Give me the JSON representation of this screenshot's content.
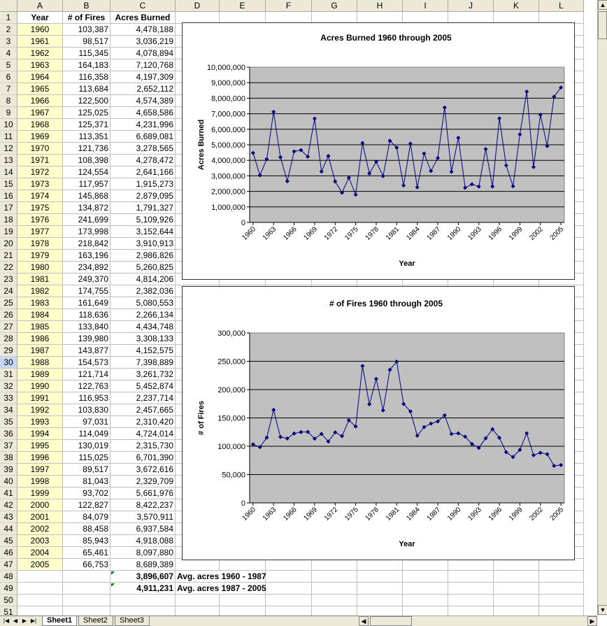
{
  "columns": [
    "A",
    "B",
    "C",
    "D",
    "E",
    "F",
    "G",
    "H",
    "I",
    "J",
    "K",
    "L"
  ],
  "header": {
    "year": "Year",
    "fires": "# of Fires",
    "acres": "Acres Burned"
  },
  "rows": [
    {
      "year": "1960",
      "fires": "103,387",
      "acres": "4,478,188"
    },
    {
      "year": "1961",
      "fires": "98,517",
      "acres": "3,036,219"
    },
    {
      "year": "1962",
      "fires": "115,345",
      "acres": "4,078,894"
    },
    {
      "year": "1963",
      "fires": "164,183",
      "acres": "7,120,768"
    },
    {
      "year": "1964",
      "fires": "116,358",
      "acres": "4,197,309"
    },
    {
      "year": "1965",
      "fires": "113,684",
      "acres": "2,652,112"
    },
    {
      "year": "1966",
      "fires": "122,500",
      "acres": "4,574,389"
    },
    {
      "year": "1967",
      "fires": "125,025",
      "acres": "4,658,586"
    },
    {
      "year": "1968",
      "fires": "125,371",
      "acres": "4,231,996"
    },
    {
      "year": "1969",
      "fires": "113,351",
      "acres": "6,689,081"
    },
    {
      "year": "1970",
      "fires": "121,736",
      "acres": "3,278,565"
    },
    {
      "year": "1971",
      "fires": "108,398",
      "acres": "4,278,472"
    },
    {
      "year": "1972",
      "fires": "124,554",
      "acres": "2,641,166"
    },
    {
      "year": "1973",
      "fires": "117,957",
      "acres": "1,915,273"
    },
    {
      "year": "1974",
      "fires": "145,868",
      "acres": "2,879,095"
    },
    {
      "year": "1975",
      "fires": "134,872",
      "acres": "1,791,327"
    },
    {
      "year": "1976",
      "fires": "241,699",
      "acres": "5,109,926"
    },
    {
      "year": "1977",
      "fires": "173,998",
      "acres": "3,152,644"
    },
    {
      "year": "1978",
      "fires": "218,842",
      "acres": "3,910,913"
    },
    {
      "year": "1979",
      "fires": "163,196",
      "acres": "2,986,826"
    },
    {
      "year": "1980",
      "fires": "234,892",
      "acres": "5,260,825"
    },
    {
      "year": "1981",
      "fires": "249,370",
      "acres": "4,814,206"
    },
    {
      "year": "1982",
      "fires": "174,755",
      "acres": "2,382,036"
    },
    {
      "year": "1983",
      "fires": "161,649",
      "acres": "5,080,553"
    },
    {
      "year": "1984",
      "fires": "118,636",
      "acres": "2,266,134"
    },
    {
      "year": "1985",
      "fires": "133,840",
      "acres": "4,434,748"
    },
    {
      "year": "1986",
      "fires": "139,980",
      "acres": "3,308,133"
    },
    {
      "year": "1987",
      "fires": "143,877",
      "acres": "4,152,575"
    },
    {
      "year": "1988",
      "fires": "154,573",
      "acres": "7,398,889"
    },
    {
      "year": "1989",
      "fires": "121,714",
      "acres": "3,261,732"
    },
    {
      "year": "1990",
      "fires": "122,763",
      "acres": "5,452,874"
    },
    {
      "year": "1991",
      "fires": "116,953",
      "acres": "2,237,714"
    },
    {
      "year": "1992",
      "fires": "103,830",
      "acres": "2,457,665"
    },
    {
      "year": "1993",
      "fires": "97,031",
      "acres": "2,310,420"
    },
    {
      "year": "1994",
      "fires": "114,049",
      "acres": "4,724,014"
    },
    {
      "year": "1995",
      "fires": "130,019",
      "acres": "2,315,730"
    },
    {
      "year": "1996",
      "fires": "115,025",
      "acres": "6,701,390"
    },
    {
      "year": "1997",
      "fires": "89,517",
      "acres": "3,672,616"
    },
    {
      "year": "1998",
      "fires": "81,043",
      "acres": "2,329,709"
    },
    {
      "year": "1999",
      "fires": "93,702",
      "acres": "5,661,976"
    },
    {
      "year": "2000",
      "fires": "122,827",
      "acres": "8,422,237"
    },
    {
      "year": "2001",
      "fires": "84,079",
      "acres": "3,570,911"
    },
    {
      "year": "2002",
      "fires": "88,458",
      "acres": "6,937,584"
    },
    {
      "year": "2003",
      "fires": "85,943",
      "acres": "4,918,088"
    },
    {
      "year": "2004",
      "fires": "65,461",
      "acres": "8,097,880"
    },
    {
      "year": "2005",
      "fires": "66,753",
      "acres": "8,689,389"
    }
  ],
  "summary": [
    {
      "value": "3,896,607",
      "label": "Avg. acres 1960 - 1987"
    },
    {
      "value": "4,911,231",
      "label": "Avg. acres 1987 - 2005"
    }
  ],
  "row_numbers": [
    "1",
    "2",
    "3",
    "4",
    "5",
    "6",
    "7",
    "8",
    "9",
    "10",
    "11",
    "12",
    "13",
    "14",
    "15",
    "16",
    "17",
    "18",
    "19",
    "20",
    "21",
    "22",
    "23",
    "24",
    "25",
    "26",
    "27",
    "28",
    "29",
    "30",
    "31",
    "32",
    "33",
    "34",
    "35",
    "36",
    "37",
    "38",
    "39",
    "40",
    "41",
    "42",
    "43",
    "44",
    "45",
    "46",
    "47",
    "48",
    "49",
    "50",
    "51"
  ],
  "selected_row": "30",
  "tabs": [
    {
      "label": "Sheet1",
      "active": true
    },
    {
      "label": "Sheet2",
      "active": false
    },
    {
      "label": "Sheet3",
      "active": false
    }
  ],
  "nav_icons": [
    "first-sheet-icon",
    "prev-sheet-icon",
    "next-sheet-icon",
    "last-sheet-icon"
  ],
  "colors": {
    "plot_bg": "#c0c0c0",
    "series": "#000080",
    "year_fill": "#ffffcc",
    "header_bg": "#ece9d8"
  },
  "chart_data": [
    {
      "type": "line",
      "title": "Acres Burned 1960 through 2005",
      "xlabel": "Year",
      "ylabel": "Acres Burned",
      "ylim": [
        0,
        10000000
      ],
      "yticks": [
        "0",
        "1,000,000",
        "2,000,000",
        "3,000,000",
        "4,000,000",
        "5,000,000",
        "6,000,000",
        "7,000,000",
        "8,000,000",
        "9,000,000",
        "10,000,000"
      ],
      "xticks": [
        "1960",
        "1963",
        "1966",
        "1969",
        "1972",
        "1975",
        "1978",
        "1981",
        "1984",
        "1987",
        "1990",
        "1993",
        "1996",
        "1999",
        "2002",
        "2005"
      ],
      "grid": true,
      "series": [
        {
          "x": [
            1960,
            1961,
            1962,
            1963,
            1964,
            1965,
            1966,
            1967,
            1968,
            1969,
            1970,
            1971,
            1972,
            1973,
            1974,
            1975,
            1976,
            1977,
            1978,
            1979,
            1980,
            1981,
            1982,
            1983,
            1984,
            1985,
            1986,
            1987,
            1988,
            1989,
            1990,
            1991,
            1992,
            1993,
            1994,
            1995,
            1996,
            1997,
            1998,
            1999,
            2000,
            2001,
            2002,
            2003,
            2004,
            2005
          ],
          "values": [
            4478188,
            3036219,
            4078894,
            7120768,
            4197309,
            2652112,
            4574389,
            4658586,
            4231996,
            6689081,
            3278565,
            4278472,
            2641166,
            1915273,
            2879095,
            1791327,
            5109926,
            3152644,
            3910913,
            2986826,
            5260825,
            4814206,
            2382036,
            5080553,
            2266134,
            4434748,
            3308133,
            4152575,
            7398889,
            3261732,
            5452874,
            2237714,
            2457665,
            2310420,
            4724014,
            2315730,
            6701390,
            3672616,
            2329709,
            5661976,
            8422237,
            3570911,
            6937584,
            4918088,
            8097880,
            8689389
          ]
        }
      ]
    },
    {
      "type": "line",
      "title": "# of Fires 1960 through 2005",
      "xlabel": "Year",
      "ylabel": "# of Fires",
      "ylim": [
        0,
        300000
      ],
      "yticks": [
        "0",
        "50,000",
        "100,000",
        "150,000",
        "200,000",
        "250,000",
        "300,000"
      ],
      "xticks": [
        "1960",
        "1963",
        "1966",
        "1969",
        "1972",
        "1975",
        "1978",
        "1981",
        "1984",
        "1987",
        "1990",
        "1993",
        "1996",
        "1999",
        "2002",
        "2005"
      ],
      "grid": true,
      "series": [
        {
          "x": [
            1960,
            1961,
            1962,
            1963,
            1964,
            1965,
            1966,
            1967,
            1968,
            1969,
            1970,
            1971,
            1972,
            1973,
            1974,
            1975,
            1976,
            1977,
            1978,
            1979,
            1980,
            1981,
            1982,
            1983,
            1984,
            1985,
            1986,
            1987,
            1988,
            1989,
            1990,
            1991,
            1992,
            1993,
            1994,
            1995,
            1996,
            1997,
            1998,
            1999,
            2000,
            2001,
            2002,
            2003,
            2004,
            2005
          ],
          "values": [
            103387,
            98517,
            115345,
            164183,
            116358,
            113684,
            122500,
            125025,
            125371,
            113351,
            121736,
            108398,
            124554,
            117957,
            145868,
            134872,
            241699,
            173998,
            218842,
            163196,
            234892,
            249370,
            174755,
            161649,
            118636,
            133840,
            139980,
            143877,
            154573,
            121714,
            122763,
            116953,
            103830,
            97031,
            114049,
            130019,
            115025,
            89517,
            81043,
            93702,
            122827,
            84079,
            88458,
            85943,
            65461,
            66753
          ]
        }
      ]
    }
  ]
}
